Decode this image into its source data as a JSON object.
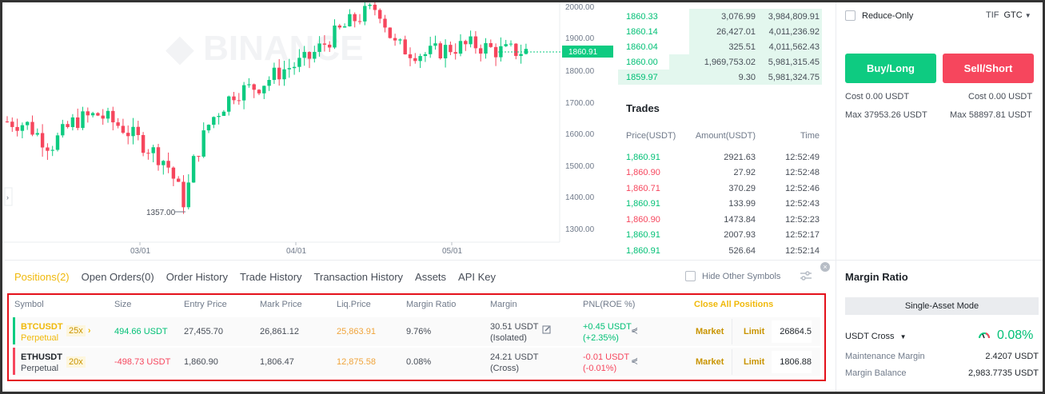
{
  "chart": {
    "price_axis": [
      "2000.00",
      "1900.00",
      "1800.00",
      "1700.00",
      "1600.00",
      "1500.00",
      "1400.00",
      "1300.00"
    ],
    "current_price": "1860.91",
    "date_axis": [
      "03/01",
      "04/01",
      "05/01"
    ],
    "low_marker": "1357.00"
  },
  "orderbook": {
    "rows": [
      {
        "price": "1860.33",
        "amount": "3,076.99",
        "total": "3,984,809.91",
        "depth": 0.65
      },
      {
        "price": "1860.14",
        "amount": "26,427.01",
        "total": "4,011,236.92",
        "depth": 0.65
      },
      {
        "price": "1860.04",
        "amount": "325.51",
        "total": "4,011,562.43",
        "depth": 0.65
      },
      {
        "price": "1860.00",
        "amount": "1,969,753.02",
        "total": "5,981,315.45",
        "depth": 0.75
      },
      {
        "price": "1859.97",
        "amount": "9.30",
        "total": "5,981,324.75",
        "depth": 0.75
      }
    ]
  },
  "trades": {
    "title": "Trades",
    "headers": {
      "price": "Price(USDT)",
      "amount": "Amount(USDT)",
      "time": "Time"
    },
    "rows": [
      {
        "price": "1,860.91",
        "amount": "2921.63",
        "time": "12:52:49",
        "dir": "up"
      },
      {
        "price": "1,860.90",
        "amount": "27.92",
        "time": "12:52:48",
        "dir": "down"
      },
      {
        "price": "1,860.71",
        "amount": "370.29",
        "time": "12:52:46",
        "dir": "down"
      },
      {
        "price": "1,860.91",
        "amount": "133.99",
        "time": "12:52:43",
        "dir": "up"
      },
      {
        "price": "1,860.90",
        "amount": "1473.84",
        "time": "12:52:23",
        "dir": "down"
      },
      {
        "price": "1,860.91",
        "amount": "2007.93",
        "time": "12:52:17",
        "dir": "up"
      },
      {
        "price": "1,860.91",
        "amount": "526.64",
        "time": "12:52:14",
        "dir": "up"
      }
    ]
  },
  "order_form": {
    "reduce_only": "Reduce-Only",
    "tif_label": "TIF",
    "tif_value": "GTC",
    "buy_label": "Buy/Long",
    "sell_label": "Sell/Short",
    "buy_cost": "Cost 0.00 USDT",
    "sell_cost": "Cost 0.00 USDT",
    "buy_max": "Max 37953.26 USDT",
    "sell_max": "Max 58897.81 USDT"
  },
  "margin": {
    "title": "Margin Ratio",
    "mode": "Single-Asset Mode",
    "account": "USDT Cross",
    "ratio": "0.08%",
    "maintenance_label": "Maintenance Margin",
    "maintenance_value": "2.4207 USDT",
    "balance_label": "Margin Balance",
    "balance_value": "2,983.7735 USDT"
  },
  "tabs": [
    "Positions(2)",
    "Open Orders(0)",
    "Order History",
    "Trade History",
    "Transaction History",
    "Assets",
    "API Key"
  ],
  "hide_other": "Hide Other Symbols",
  "positions": {
    "headers": {
      "symbol": "Symbol",
      "size": "Size",
      "entry": "Entry Price",
      "mark": "Mark Price",
      "liq": "Liq.Price",
      "ratio": "Margin Ratio",
      "margin": "Margin",
      "pnl": "PNL(ROE %)",
      "close_all": "Close All Positions"
    },
    "rows": [
      {
        "symbol": "BTCUSDT",
        "type": "Perpetual",
        "leverage": "25x",
        "size": "494.66 USDT",
        "entry": "27,455.70",
        "mark": "26,861.12",
        "liq": "25,863.91",
        "ratio": "9.76%",
        "margin": "30.51 USDT",
        "margin_mode": "(Isolated)",
        "pnl": "+0.45 USDT",
        "roe": "(+2.35%)",
        "market": "Market",
        "limit": "Limit",
        "qty": "26864.5"
      },
      {
        "symbol": "ETHUSDT",
        "type": "Perpetual",
        "leverage": "20x",
        "size": "-498.73 USDT",
        "entry": "1,860.90",
        "mark": "1,806.47",
        "liq": "12,875.58",
        "ratio": "0.08%",
        "margin": "24.21 USDT",
        "margin_mode": "(Cross)",
        "pnl": "-0.01 USDT",
        "roe": "(-0.01%)",
        "market": "Market",
        "limit": "Limit",
        "qty": "1806.88"
      }
    ]
  },
  "colors": {
    "up": "#0ecb81",
    "down": "#f6465d",
    "accent": "#f0b90b"
  }
}
